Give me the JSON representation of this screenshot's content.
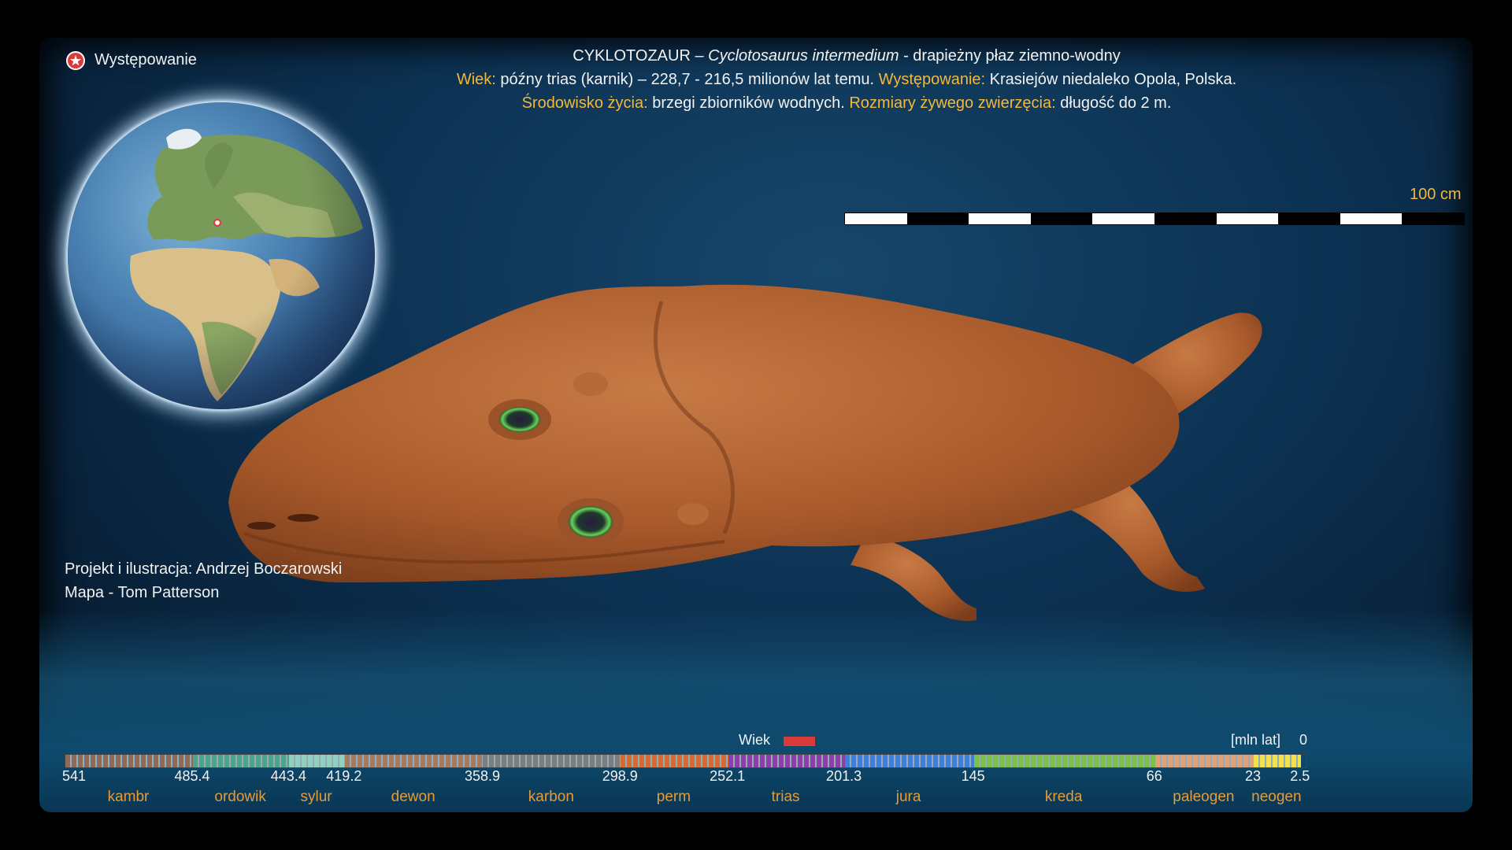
{
  "legend": {
    "label": "Występowanie"
  },
  "header": {
    "line1": {
      "name": "CYKLOTOZAUR",
      "dash": "–",
      "latin": "Cyclotosaurus  intermedium",
      "desc": "- drapieżny płaz  ziemno-wodny"
    },
    "line2": {
      "age_label": "Wiek:",
      "age_value": "późny trias (karnik) – 228,7 - 216,5 milionów lat temu.",
      "occ_label": "Występowanie:",
      "occ_value": "Krasiejów niedaleko Opola, Polska."
    },
    "line3": {
      "env_label": "Środowisko życia:",
      "env_value": "brzegi zbiorników wodnych.",
      "size_label": "Rozmiary żywego zwierzęcia:",
      "size_value": "długość do 2 m."
    }
  },
  "scale": {
    "label": "100 cm"
  },
  "credits": {
    "line1": "Projekt i ilustracja: Andrzej Boczarowski",
    "line2": "Mapa - Tom Patterson"
  },
  "timeline": {
    "age_label": "Wiek",
    "unit_label": "[mln lat]",
    "zero_label": "0",
    "ticks": [
      "541",
      "485.4",
      "443.4",
      "419.2",
      "358.9",
      "298.9",
      "252.1",
      "201.3",
      "145",
      "66",
      "23",
      "2.5"
    ],
    "periods": [
      "kambr",
      "ordowik",
      "sylur",
      "dewon",
      "karbon",
      "perm",
      "trias",
      "jura",
      "kreda",
      "paleogen",
      "neogen"
    ],
    "colors": [
      "#8c6b5a",
      "#4fa38a",
      "#8fd1be",
      "#a67a5f",
      "#7d7d7d",
      "#d36b32",
      "#8b3fa6",
      "#3f7fd9",
      "#7cc04a",
      "#e0a07a",
      "#f2e24a"
    ],
    "age_marker_color": "#d93a3a"
  },
  "colors": {
    "accent": "#f4b83a",
    "star": "#d93a3a"
  }
}
